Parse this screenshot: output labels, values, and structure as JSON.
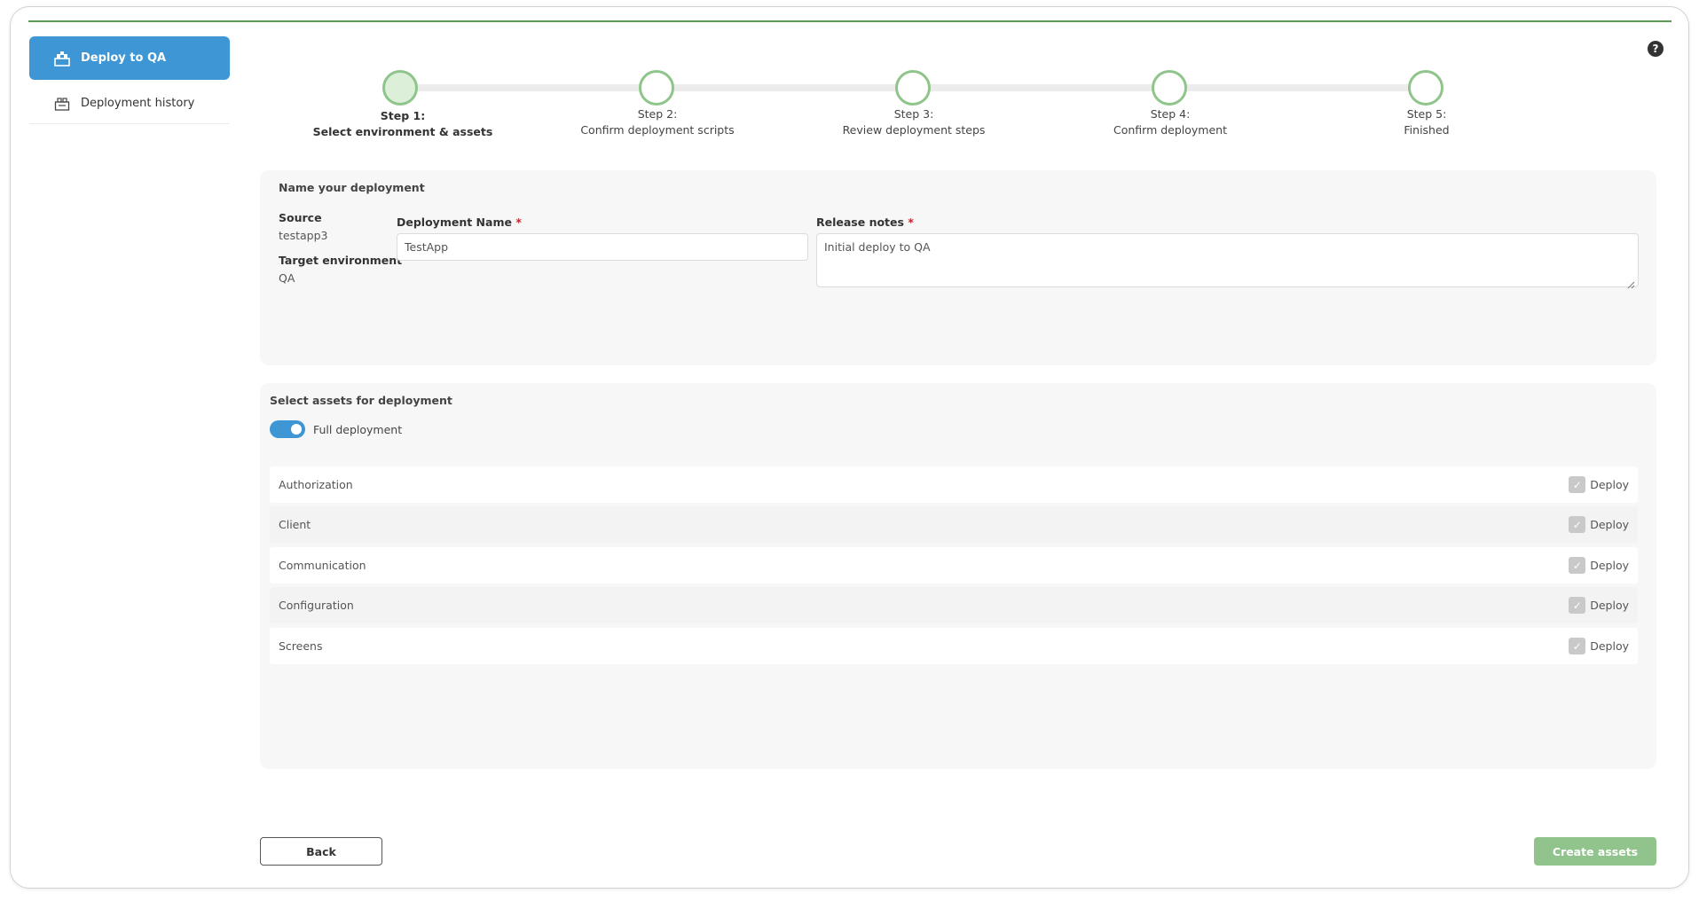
{
  "sidebar": {
    "items": [
      {
        "label": "Deploy to QA",
        "icon": "deploy-icon",
        "active": true
      },
      {
        "label": "Deployment history",
        "icon": "history-icon",
        "active": false
      }
    ]
  },
  "help_icon": "help-icon",
  "stepper": {
    "steps": [
      {
        "step": "Step 1:",
        "title": "Select environment & assets",
        "status": "active"
      },
      {
        "step": "Step 2:",
        "title": "Confirm deployment scripts",
        "status": "pending"
      },
      {
        "step": "Step 3:",
        "title": "Review deployment steps",
        "status": "pending"
      },
      {
        "step": "Step 4:",
        "title": "Confirm deployment",
        "status": "pending"
      },
      {
        "step": "Step 5:",
        "title": "Finished",
        "status": "pending"
      }
    ]
  },
  "name_panel": {
    "title": "Name your deployment",
    "source_label": "Source",
    "source_value": "testapp3",
    "target_label": "Target environment",
    "target_value": "QA",
    "deployment_name_label": "Deployment Name",
    "deployment_name_value": "TestApp",
    "release_notes_label": "Release notes",
    "release_notes_value": "Initial deploy to QA",
    "required_marker": "*"
  },
  "assets_panel": {
    "title": "Select assets for deployment",
    "full_deployment_label": "Full deployment",
    "full_deployment_on": true,
    "deploy_label": "Deploy",
    "assets": [
      {
        "name": "Authorization",
        "checked": true
      },
      {
        "name": "Client",
        "checked": true
      },
      {
        "name": "Communication",
        "checked": true
      },
      {
        "name": "Configuration",
        "checked": true
      },
      {
        "name": "Screens",
        "checked": true
      }
    ]
  },
  "footer": {
    "back_label": "Back",
    "create_label": "Create assets"
  },
  "colors": {
    "accent_blue": "#3f96d4",
    "accent_green": "#90c48c",
    "top_line": "#5a9e55"
  }
}
